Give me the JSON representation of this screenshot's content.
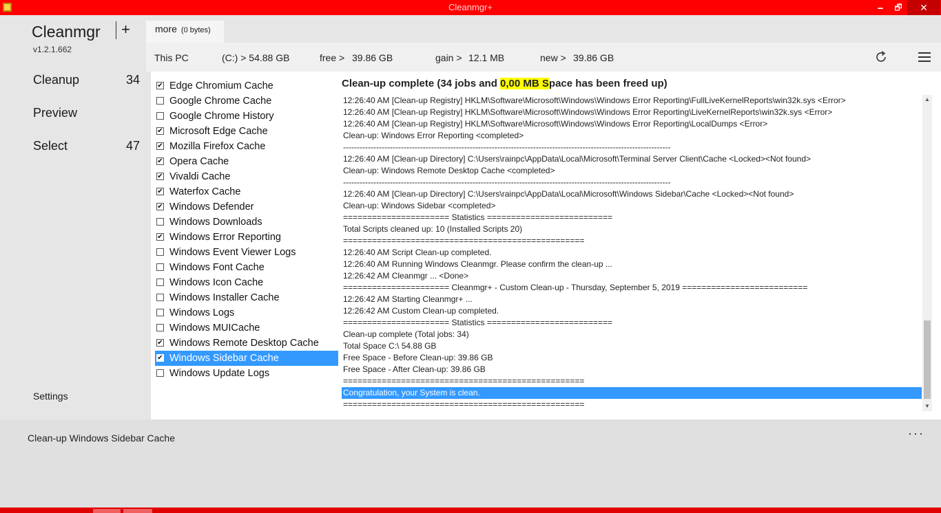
{
  "window": {
    "title": "Cleanmgr+",
    "minimize": "🗕",
    "maximize": "🗗",
    "close": "✕"
  },
  "app": {
    "name": "Cleanmgr",
    "version": "v1.2.1.662",
    "plus": "+"
  },
  "tab": {
    "label": "more",
    "bytes": "(0 bytes)"
  },
  "nav": [
    {
      "label": "Cleanup",
      "count": "34"
    },
    {
      "label": "Preview",
      "count": ""
    },
    {
      "label": "Select",
      "count": "47"
    }
  ],
  "settings_label": "Settings",
  "header": {
    "pc": "This PC",
    "drive": "(C:) > 54.88 GB",
    "free_label": "free >",
    "free_value": "39.86 GB",
    "gain_label": "gain >",
    "gain_value": "12.1 MB",
    "new_label": "new >",
    "new_value": "39.86 GB"
  },
  "jobs": [
    {
      "label": "Edge Chromium Cache",
      "checked": true
    },
    {
      "label": "Google Chrome Cache",
      "checked": false
    },
    {
      "label": "Google Chrome History",
      "checked": false
    },
    {
      "label": "Microsoft Edge Cache",
      "checked": true
    },
    {
      "label": "Mozilla Firefox Cache",
      "checked": true
    },
    {
      "label": "Opera Cache",
      "checked": true
    },
    {
      "label": "Vivaldi Cache",
      "checked": true
    },
    {
      "label": "Waterfox Cache",
      "checked": true
    },
    {
      "label": "Windows Defender",
      "checked": true
    },
    {
      "label": "Windows Downloads",
      "checked": false
    },
    {
      "label": "Windows Error Reporting",
      "checked": true
    },
    {
      "label": "Windows Event Viewer Logs",
      "checked": false
    },
    {
      "label": "Windows Font Cache",
      "checked": false
    },
    {
      "label": "Windows Icon Cache",
      "checked": false
    },
    {
      "label": "Windows Installer Cache",
      "checked": false
    },
    {
      "label": "Windows Logs",
      "checked": false
    },
    {
      "label": "Windows MUICache",
      "checked": false
    },
    {
      "label": "Windows Remote Desktop Cache",
      "checked": true
    },
    {
      "label": "Windows Sidebar Cache",
      "checked": true,
      "selected": true
    },
    {
      "label": "Windows Update Logs",
      "checked": false
    }
  ],
  "log_title": {
    "before": "Clean-up complete (34 jobs and ",
    "highlight": "0,00 MB S",
    "after": "pace has been freed up)"
  },
  "log_lines": [
    "12:26:40 AM [Clean-up Registry] HKLM\\Software\\Microsoft\\Windows\\Windows Error Reporting\\FullLiveKernelReports\\win32k.sys <Error>",
    "12:26:40 AM [Clean-up Registry] HKLM\\Software\\Microsoft\\Windows\\Windows Error Reporting\\LiveKernelReports\\win32k.sys <Error>",
    "12:26:40 AM [Clean-up Registry] HKLM\\Software\\Microsoft\\Windows\\Windows Error Reporting\\LocalDumps <Error>",
    "Clean-up: Windows Error Reporting <completed>",
    "-----------------------------------------------------------------------------------------------------------------------",
    "12:26:40 AM [Clean-up Directory] C:\\Users\\rainpc\\AppData\\Local\\Microsoft\\Terminal Server Client\\Cache <Locked><Not found>",
    "Clean-up: Windows Remote Desktop Cache <completed>",
    "-----------------------------------------------------------------------------------------------------------------------",
    "12:26:40 AM [Clean-up Directory] C:\\Users\\rainpc\\AppData\\Local\\Microsoft\\Windows Sidebar\\Cache <Locked><Not found>",
    "Clean-up: Windows Sidebar <completed>",
    "====================== Statistics ==========================",
    "Total Scripts cleaned up: 10 (Installed Scripts 20)",
    "==================================================",
    "12:26:40 AM Script Clean-up completed.",
    "12:26:40 AM Running Windows Cleanmgr. Please confirm the clean-up ...",
    "12:26:42 AM Cleanmgr ... <Done>",
    "====================== Cleanmgr+ - Custom Clean-up - Thursday, September 5, 2019 ==========================",
    "12:26:42 AM Starting Cleanmgr+ ...",
    "12:26:42 AM Custom Clean-up completed.",
    "====================== Statistics ==========================",
    "Clean-up complete (Total jobs: 34)",
    "Total Space C:\\ 54.88 GB",
    "Free Space - Before Clean-up: 39.86 GB",
    "Free Space - After Clean-up: 39.86 GB",
    "==================================================",
    "Congratulation, your System is clean.",
    "=================================================="
  ],
  "log_selected_index": 25,
  "status_text": "Clean-up Windows Sidebar Cache",
  "more_menu": "···",
  "colors": {
    "titlebar": "#ff0000",
    "selection": "#3399ff",
    "highlight": "#ffff00"
  }
}
